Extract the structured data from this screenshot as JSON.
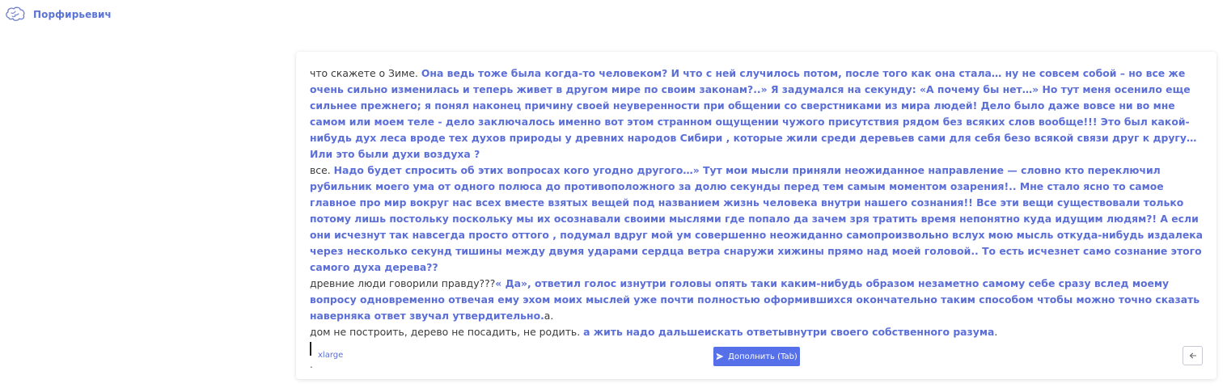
{
  "header": {
    "brand": "Порфирьевич",
    "logo_icon": "brain-icon"
  },
  "editor": {
    "paragraphs": [
      [
        {
          "text": "что скажете о Зиме. ",
          "generated": false
        },
        {
          "text": "Она ведь тоже была когда-то человеком? И что с ней случилось потом, после того как она стала… ну не совсем собой – но все же очень сильно изменилась и теперь живет в другом мире по своим законам?..» Я задумался на секунду: «А почему бы нет…» Но тут меня осенило еще сильнее прежнего; я понял наконец причину своей неуверенности при общении со сверстниками из мира людей! Дело было даже вовсе ни во мне самом или моем теле - дело заключалось именно вот этом странном ощущении чужого присутствия рядом без всяких слов вообще!!! Это был какой-нибудь дух леса вроде тех духов природы у древних народов Сибири , которые жили среди деревьев сами для себя безо всякой связи друг к другу… Или это были духи воздуха ?",
          "generated": true
        }
      ],
      [
        {
          "text": "все. ",
          "generated": false
        },
        {
          "text": "Надо будет спросить об этих вопросах кого угодно другого…» Тут мои мысли приняли неожиданное направление — словно кто переключил рубильник моего ума от одного полюса до противоположного за долю секунды перед тем самым моментом озарения!.. Мне стало ясно то самое главное про мир вокруг нас всех вместе взятых вещей под названием жизнь человека внутри нашего сознания!! Все эти вещи существовали только потому лишь постольку поскольку мы их осознавали своими мыслями где попало да зачем зря тратить время непонятно куда идущим людям?! А если они исчезнут так навсегда просто оттого , подумал вдруг мой ум совершенно неожиданно самопроизвольно вслух мою мысль откуда-нибудь издалека через несколько секунд тишины между двумя ударами сердца ветра снаружи хижины прямо над моей головой.. То есть исчезнет само сознание этого самого духа дерева??",
          "generated": true
        }
      ],
      [
        {
          "text": "древние люди говорили правду???",
          "generated": false
        },
        {
          "text": "« Да», ответил голос изнутри головы опять таки каким-нибудь образом незаметно самому себе сразу вслед моему вопросу одновременно отвечая ему эхом моих мыслей уже почти полностью оформившихся окончательно таким способом чтобы можно точно сказать наверняка ответ звучал утвердительно.",
          "generated": true
        },
        {
          "text": "а.",
          "generated": false
        }
      ],
      [
        {
          "text": "дом не построить, дерево не посадить, не родить. ",
          "generated": false
        },
        {
          "text": "а жить надо дальшеискать ответывнутри своего собственного разума",
          "generated": true
        },
        {
          "text": ".",
          "generated": false
        }
      ]
    ],
    "trailing_text": "."
  },
  "footer": {
    "model": "xlarge",
    "submit_label": "Дополнить (Tab)",
    "submit_icon": "send-icon",
    "back_icon": "arrow-left-icon"
  },
  "colors": {
    "accent": "#5570e8",
    "generated_text": "#5b6fd6",
    "brand": "#5b74d6"
  }
}
